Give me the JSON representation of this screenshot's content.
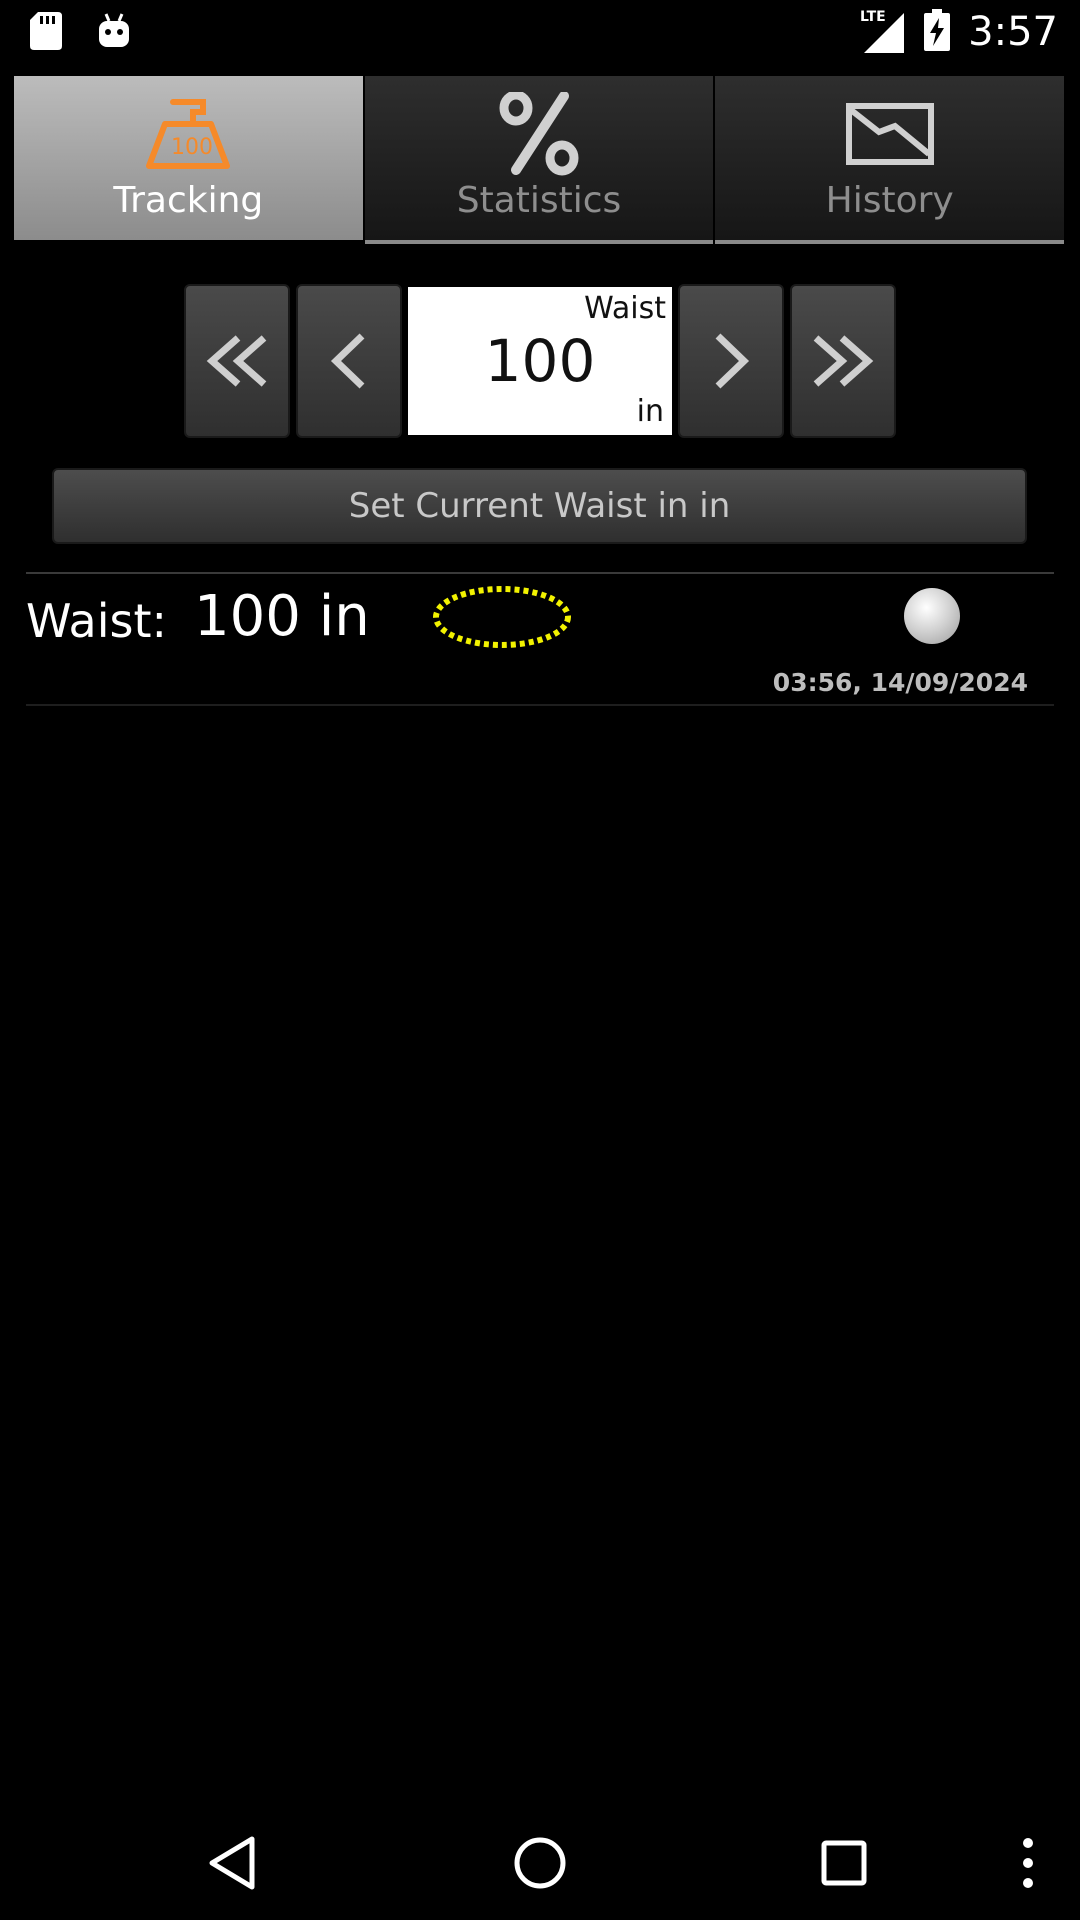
{
  "status_bar": {
    "time": "3:57",
    "network": "LTE",
    "icons": [
      "sd-card-icon",
      "android-icon",
      "signal-icon",
      "battery-charging-icon"
    ]
  },
  "tabs": [
    {
      "label": "Tracking",
      "icon": "weight-scale-icon",
      "active": true
    },
    {
      "label": "Statistics",
      "icon": "percent-icon",
      "active": false
    },
    {
      "label": "History",
      "icon": "chart-icon",
      "active": false
    }
  ],
  "stepper": {
    "label": "Waist",
    "value": "100",
    "unit": "in"
  },
  "set_button": "Set Current Waist in in",
  "entry": {
    "label": "Waist:",
    "value": "100 in",
    "timestamp": "03:56, 14/09/2024"
  },
  "colors": {
    "accent_orange": "#f58a2a",
    "marker_yellow": "#f2f200"
  }
}
